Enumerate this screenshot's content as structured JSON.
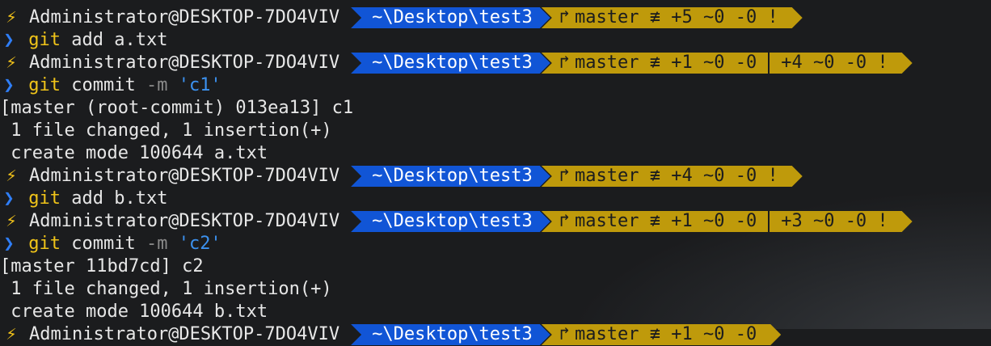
{
  "prompt": {
    "bolt_glyph": "⚡",
    "user_host": "Administrator@DESKTOP-7DO4VIV",
    "path": "~\\Desktop\\test3",
    "branch_glyph": "↱",
    "input_glyph": "❯",
    "colors": {
      "path_bg": "#1155d6",
      "git_bg": "#bf9a0b",
      "bolt": "#f2c21a",
      "command": "#f0c419",
      "string": "#3c92f0",
      "prompt_char": "#2f7ef7"
    }
  },
  "blocks": [
    {
      "git_status": "master ≢ +5 ~0 -0 !",
      "git_status_extra": "",
      "command": {
        "name": "git",
        "args": "add a.txt",
        "flag": "",
        "string": ""
      },
      "output": []
    },
    {
      "git_status": "master ≢ +1 ~0 -0",
      "git_status_extra": "+4 ~0 -0 !",
      "command": {
        "name": "git",
        "args": "commit",
        "flag": "-m",
        "string": "'c1'"
      },
      "output": [
        "[master (root-commit) 013ea13] c1",
        " 1 file changed, 1 insertion(+)",
        " create mode 100644 a.txt"
      ]
    },
    {
      "git_status": "master ≢ +4 ~0 -0 !",
      "git_status_extra": "",
      "command": {
        "name": "git",
        "args": "add b.txt",
        "flag": "",
        "string": ""
      },
      "output": []
    },
    {
      "git_status": "master ≢ +1 ~0 -0",
      "git_status_extra": "+3 ~0 -0 !",
      "command": {
        "name": "git",
        "args": "commit",
        "flag": "-m",
        "string": "'c2'"
      },
      "output": [
        "[master 11bd7cd] c2",
        " 1 file changed, 1 insertion(+)",
        " create mode 100644 b.txt"
      ]
    }
  ]
}
